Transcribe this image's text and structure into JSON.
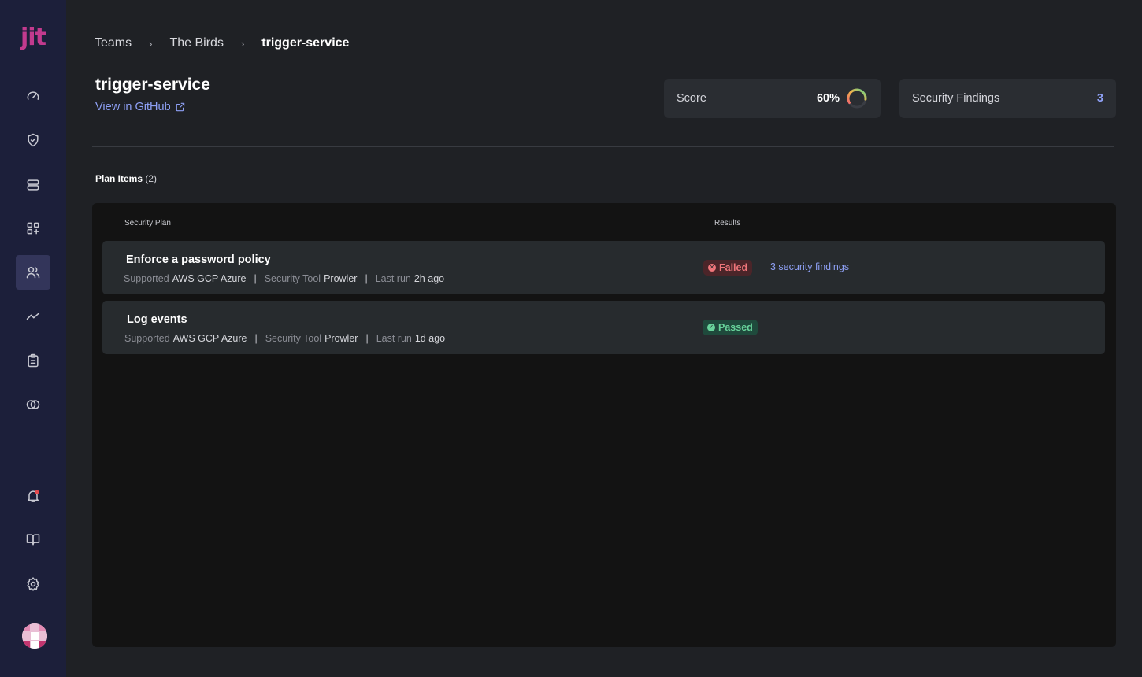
{
  "app": {
    "logo_text": "jit"
  },
  "sidebar": {
    "items": [
      {
        "name": "dashboard",
        "icon": "gauge-icon"
      },
      {
        "name": "security-plan",
        "icon": "shield-check-icon"
      },
      {
        "name": "resources",
        "icon": "stack-icon"
      },
      {
        "name": "integrations",
        "icon": "apps-plus-icon"
      },
      {
        "name": "teams",
        "icon": "users-icon",
        "active": true
      },
      {
        "name": "insights",
        "icon": "trend-line-icon"
      },
      {
        "name": "reports",
        "icon": "clipboard-icon"
      },
      {
        "name": "compliance",
        "icon": "overlap-circles-icon"
      }
    ],
    "bottom": [
      "bell-icon",
      "book-icon",
      "gear-icon",
      "avatar"
    ]
  },
  "breadcrumb": {
    "teams": "Teams",
    "team": "The Birds",
    "current": "trigger-service"
  },
  "page": {
    "title": "trigger-service",
    "github_link": "View in GitHub"
  },
  "score": {
    "label": "Score",
    "value": "60%",
    "fraction": 0.6
  },
  "findings": {
    "label": "Security Findings",
    "count": "3"
  },
  "plan": {
    "heading": "Plan Items",
    "count": "(2)",
    "columns": {
      "plan": "Security Plan",
      "results": "Results"
    },
    "rows": [
      {
        "title": "Enforce a password policy",
        "supported_label": "Supported",
        "supported_value": "AWS GCP Azure",
        "tool_label": "Security Tool",
        "tool_value": "Prowler",
        "lastrun_label": "Last run",
        "lastrun_value": "2h ago",
        "status": "Failed",
        "findings_link": "3 security findings"
      },
      {
        "title": "Log events",
        "supported_label": "Supported",
        "supported_value": "AWS GCP Azure",
        "tool_label": "Security Tool",
        "tool_value": "Prowler",
        "lastrun_label": "Last run",
        "lastrun_value": "1d ago",
        "status": "Passed"
      }
    ]
  },
  "colors": {
    "sidebar_bg": "#1c1f3a",
    "brand": "#c23a8e",
    "link": "#8ea0f5",
    "failed": "#f0767b",
    "passed": "#68d39b"
  }
}
